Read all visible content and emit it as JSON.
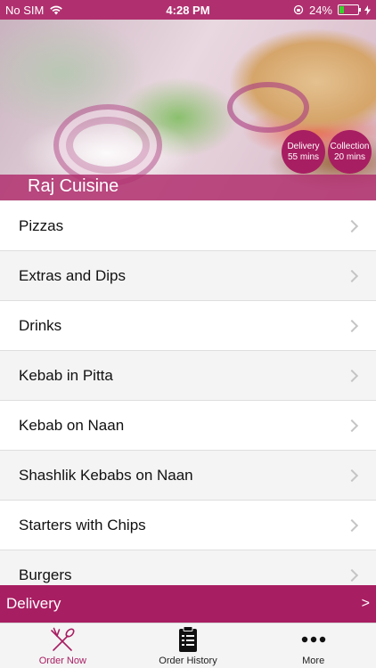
{
  "status_bar": {
    "carrier": "No SIM",
    "time": "4:28 PM",
    "battery": "24%",
    "battery_level": 0.24
  },
  "header": {
    "restaurant_name": "Raj Cuisine",
    "delivery_label": "Delivery",
    "delivery_time": "55 mins",
    "collection_label": "Collection",
    "collection_time": "20 mins"
  },
  "menu": {
    "items": [
      {
        "label": "Pizzas"
      },
      {
        "label": "Extras and Dips"
      },
      {
        "label": "Drinks"
      },
      {
        "label": "Kebab in Pitta"
      },
      {
        "label": "Kebab on Naan"
      },
      {
        "label": "Shashlik Kebabs on Naan"
      },
      {
        "label": "Starters with Chips"
      },
      {
        "label": "Burgers"
      }
    ]
  },
  "order_bar": {
    "label": "Delivery",
    "arrow": ">"
  },
  "tab_bar": {
    "tabs": [
      {
        "label": "Order Now",
        "icon": "cutlery-icon",
        "active": true
      },
      {
        "label": "Order History",
        "icon": "clipboard-icon",
        "active": false
      },
      {
        "label": "More",
        "icon": "more-dots-icon",
        "active": false
      }
    ]
  },
  "colors": {
    "brand": "#a81e62",
    "status_bar": "#b0306f",
    "battery_fill": "#3ad12b"
  }
}
